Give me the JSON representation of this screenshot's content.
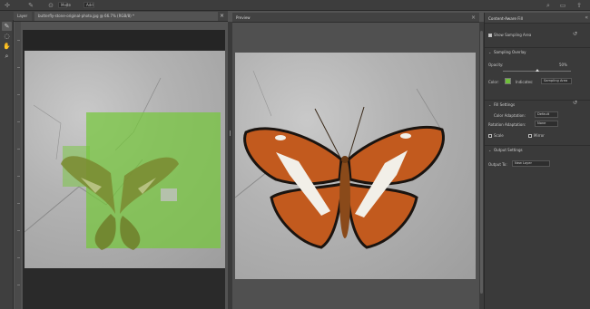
{
  "options_bar": {
    "mode_label": "Mode",
    "mode_value": "Add",
    "field_value": ""
  },
  "document_tabs": {
    "left_tab": "Layer",
    "main_tab": "butterfly-stone-original-photo.jpg @ 66.7% (RGB/8) *",
    "close_glyph": "×"
  },
  "preview": {
    "label": "Preview",
    "close_glyph": "×"
  },
  "tools": {
    "brush": "✎",
    "lasso": "◌",
    "hand": "✋",
    "zoom": "⌕"
  },
  "panel": {
    "title": "Content-Aware Fill",
    "collapse_glyph": "«",
    "show_sampling_area_label": "Show Sampling Area",
    "show_sampling_area_checked": true,
    "sampling_overlay_section": "Sampling Overlay",
    "opacity_label": "Opacity:",
    "opacity_value": "50%",
    "opacity_fraction": 0.5,
    "color_label": "Color:",
    "indicates_label": "Indicates:",
    "indicates_value": "Sampling Area",
    "fill_settings_section": "Fill Settings",
    "color_adaptation_label": "Color Adaptation:",
    "color_adaptation_value": "Default",
    "rotation_adaptation_label": "Rotation Adaptation:",
    "rotation_adaptation_value": "None",
    "scale_label": "Scale",
    "mirror_label": "Mirror",
    "output_settings_section": "Output Settings",
    "output_to_label": "Output To:",
    "output_to_value": "New Layer",
    "reset_glyph": "↺",
    "chevron": "⌄"
  },
  "colors": {
    "overlay_green": "#76c83c",
    "swatch_green": "#6fbf3a",
    "ui_dark": "#3a3a3a"
  }
}
